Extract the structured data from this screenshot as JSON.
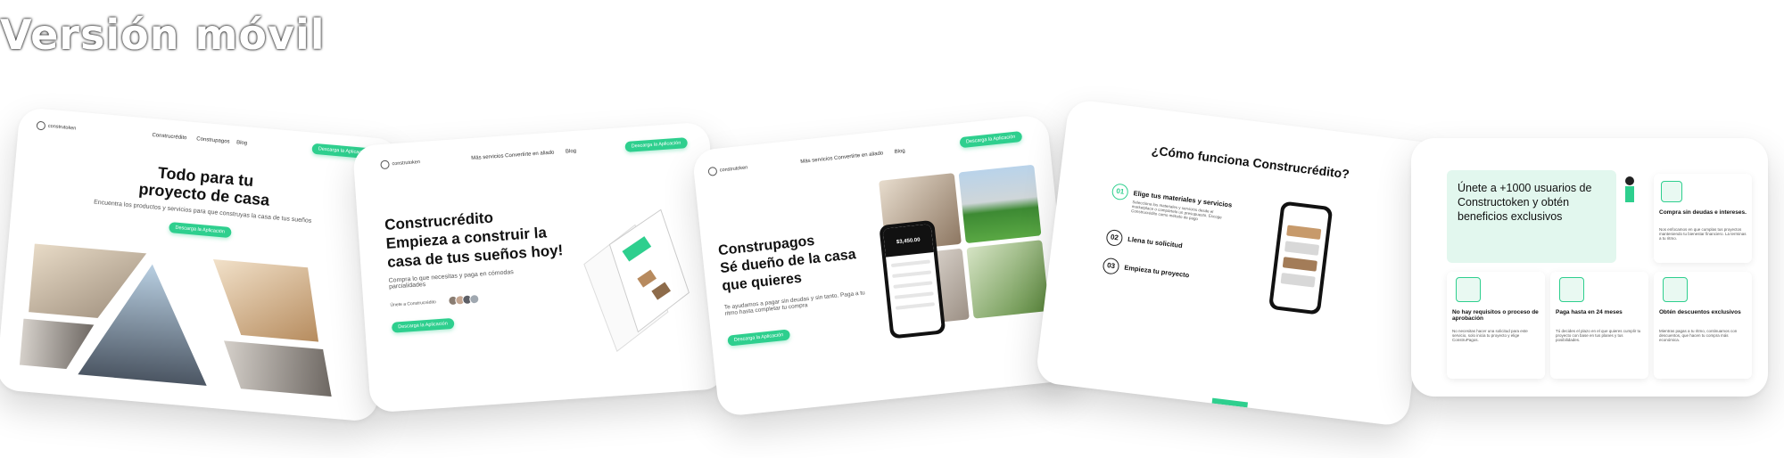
{
  "header": {
    "title": "Versión móvil"
  },
  "colors": {
    "accent": "#2ecf8e",
    "dark": "#111111"
  },
  "card1": {
    "logo": "construtoken",
    "nav": [
      "Construcrédito",
      "Construpagos",
      "Blog"
    ],
    "download_btn": "Descarga la Aplicación",
    "heading_line1": "Todo para tu",
    "heading_line2": "proyecto de casa",
    "subtitle": "Encuentra los productos y servicios para que construyas la casa de tus sueños",
    "cta": "Descarga la Aplicación"
  },
  "card2": {
    "logo": "construtoken",
    "nav": [
      "Más servicios",
      "Convertirte en aliado",
      "Blog"
    ],
    "download_btn": "Descarga la Aplicación",
    "heading_line1": "Construcrédito",
    "heading_line2": "Empieza a construir la",
    "heading_line3": "casa de tus sueños hoy!",
    "subtitle": "Compra lo que necesitas y paga en cómodas parcialidades",
    "join_text": "Únete a Construcrédito",
    "cta": "Descarga la Aplicación"
  },
  "card3": {
    "logo": "construtoken",
    "nav": [
      "Más servicios",
      "Convertirte en aliado",
      "Blog"
    ],
    "download_btn": "Descarga la Aplicación",
    "heading_line1": "Construpagos",
    "heading_line2": "Sé dueño de la casa",
    "heading_line3": "que quieres",
    "subtitle": "Te ayudamos a pagar sin deudas y sin tanto. Paga a tu ritmo hasta completar tu compra",
    "cta": "Descarga la Aplicación",
    "phone_amount": "$3,450.00"
  },
  "card4": {
    "heading": "¿Cómo funciona Construcrédito?",
    "steps": [
      {
        "num": "01",
        "label": "Elige tus materiales y servicios",
        "desc": "Selecciona los materiales y servicios desde el marketplace o compártelo un presupuesto. Escoge Construcrédito como método de pago"
      },
      {
        "num": "02",
        "label": "Llena tu solicitud",
        "desc": ""
      },
      {
        "num": "03",
        "label": "Empieza tu proyecto",
        "desc": ""
      }
    ]
  },
  "card5": {
    "banner": "Únete a +1000 usuarios de Constructoken y obtén beneficios exclusivos",
    "features": [
      {
        "title": "Compra sin deudas e intereses.",
        "desc": "Nos enfocamos en que cumplas tus proyectos manteniendo tu bienestar financiero. La terminas a tu ritmo."
      },
      {
        "title": "No hay requisitos o proceso de aprobación",
        "desc": "No necesitas hacer una solicitud para este servicio, solo inicia tu proyecto y elige ConstruPagos."
      },
      {
        "title": "Paga hasta en 24 meses",
        "desc": "Tú decides el plazo en el que quieres cumplir tu proyecto con base en tus planes y tus posibilidades."
      },
      {
        "title": "Obtén descuentos exclusivos",
        "desc": "Mientras pagas a tu ritmo, continuamos con descuentos, que hacen tu compra más económica."
      }
    ]
  }
}
